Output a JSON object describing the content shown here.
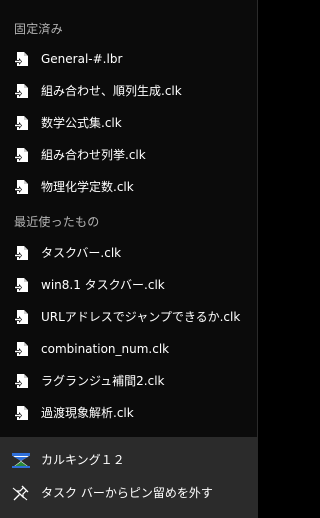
{
  "jumplist": {
    "pinned": {
      "header": "固定済み",
      "items": [
        {
          "label": "General-#.lbr"
        },
        {
          "label": "組み合わせ、順列生成.clk"
        },
        {
          "label": "数学公式集.clk"
        },
        {
          "label": "組み合わせ列挙.clk"
        },
        {
          "label": "物理化学定数.clk"
        }
      ]
    },
    "recent": {
      "header": "最近使ったもの",
      "items": [
        {
          "label": "タスクバー.clk"
        },
        {
          "label": "win8.1 タスクバー.clk"
        },
        {
          "label": "URLアドレスでジャンプできるか.clk"
        },
        {
          "label": "combination_num.clk"
        },
        {
          "label": "ラグランジュ補間2.clk"
        },
        {
          "label": "過渡現象解析.clk"
        }
      ]
    },
    "footer": {
      "app_label": "カルキング１２",
      "unpin_label": "タスク バーからピン留めを外す"
    },
    "icons": {
      "file": "document-file-icon",
      "app": "calking-app-icon",
      "unpin": "unpin-icon"
    },
    "colors": {
      "background": "#0b0b0b",
      "footer_background": "#2b2b2b",
      "text": "#ffffff",
      "header_text": "#b3b3b3"
    }
  }
}
